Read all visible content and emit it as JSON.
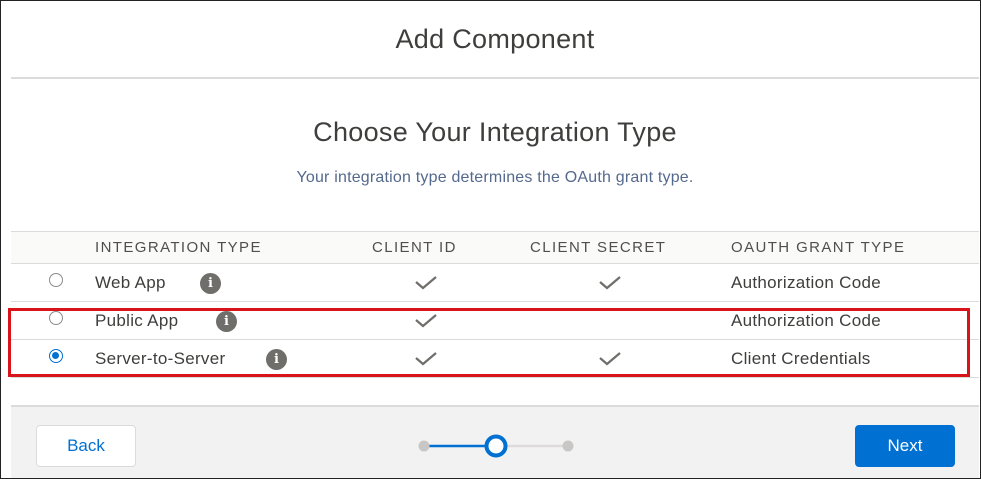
{
  "modal": {
    "title": "Add Component"
  },
  "step": {
    "heading": "Choose Your Integration Type",
    "subheading": "Your integration type determines the OAuth grant type."
  },
  "table": {
    "columns": [
      "INTEGRATION TYPE",
      "CLIENT ID",
      "CLIENT SECRET",
      "OAUTH GRANT TYPE"
    ],
    "rows": [
      {
        "name": "Web App",
        "client_id": true,
        "client_secret": true,
        "grant": "Authorization Code",
        "selected": false
      },
      {
        "name": "Public App",
        "client_id": true,
        "client_secret": false,
        "grant": "Authorization Code",
        "selected": false
      },
      {
        "name": "Server-to-Server",
        "client_id": true,
        "client_secret": true,
        "grant": "Client Credentials",
        "selected": true
      }
    ],
    "info_glyph": "i"
  },
  "footer": {
    "back_label": "Back",
    "next_label": "Next",
    "progress": {
      "total_steps": 3,
      "current_step": 2
    }
  },
  "icons": {
    "check": "check-icon",
    "info": "info-icon"
  },
  "colors": {
    "brand": "#0070d2",
    "highlight": "#d9131a",
    "check": "#706e6b"
  }
}
